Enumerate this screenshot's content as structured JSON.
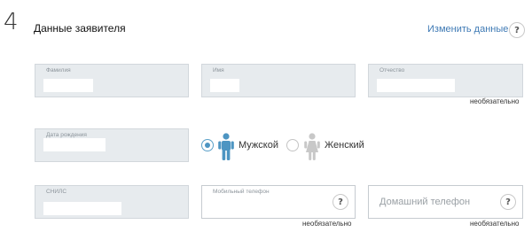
{
  "section": {
    "number": "4",
    "title": "Данные заявителя",
    "change_link": "Изменить данные",
    "help_glyph": "?"
  },
  "fields": {
    "lastname": {
      "label": "Фамилия"
    },
    "firstname": {
      "label": "Имя"
    },
    "patronymic": {
      "label": "Отчество",
      "note": "необязательно"
    },
    "birthdate": {
      "label": "Дата рождения"
    },
    "snils": {
      "label": "СНИЛС"
    },
    "mobile": {
      "label": "Мобильный телефон",
      "note": "необязательно"
    },
    "home_phone": {
      "placeholder": "Домашний телефон",
      "note": "необязательно"
    }
  },
  "gender": {
    "male_label": "Мужской",
    "female_label": "Женский",
    "selected": "male",
    "male_color": "#4d95c2",
    "female_color": "#c8c8c8"
  }
}
